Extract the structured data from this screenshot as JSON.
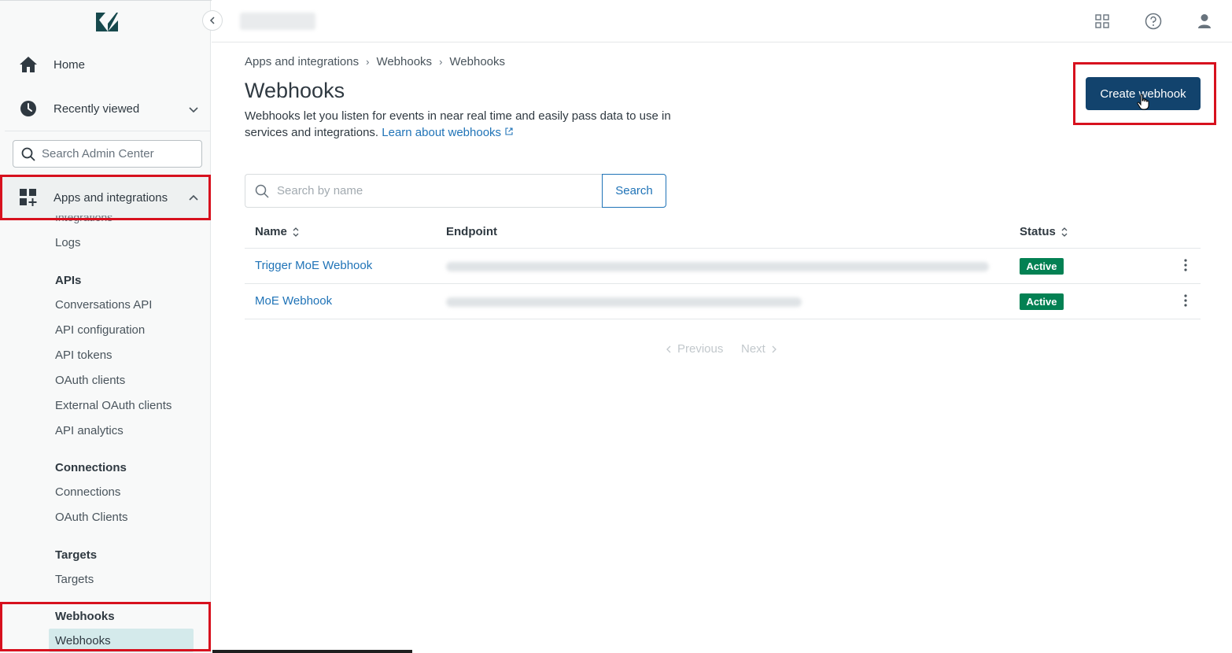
{
  "sidebar": {
    "home_label": "Home",
    "recently_viewed_label": "Recently viewed",
    "search_placeholder": "Search Admin Center",
    "apps_label": "Apps and integrations",
    "cutoff_label": "Integrations",
    "logs_label": "Logs",
    "groups": [
      {
        "title": "APIs",
        "items": [
          "Conversations API",
          "API configuration",
          "API tokens",
          "OAuth clients",
          "External OAuth clients",
          "API analytics"
        ]
      },
      {
        "title": "Connections",
        "items": [
          "Connections",
          "OAuth Clients"
        ]
      },
      {
        "title": "Targets",
        "items": [
          "Targets"
        ]
      },
      {
        "title": "Webhooks",
        "items": [
          "Webhooks"
        ]
      }
    ]
  },
  "breadcrumb": [
    "Apps and integrations",
    "Webhooks",
    "Webhooks"
  ],
  "page": {
    "title": "Webhooks",
    "description": "Webhooks let you listen for events in near real time and easily pass data to use in services and integrations.",
    "learn_link": "Learn about webhooks",
    "create_button": "Create webhook"
  },
  "search": {
    "placeholder": "Search by name",
    "button": "Search"
  },
  "table": {
    "headers": {
      "name": "Name",
      "endpoint": "Endpoint",
      "status": "Status"
    },
    "rows": [
      {
        "name": "Trigger MoE Webhook",
        "status": "Active"
      },
      {
        "name": "MoE Webhook",
        "status": "Active"
      }
    ]
  },
  "pagination": {
    "previous": "Previous",
    "next": "Next"
  },
  "colors": {
    "brand_dark": "#12436d",
    "link": "#1f73b7",
    "active": "#038153",
    "highlight": "#d7111e"
  }
}
